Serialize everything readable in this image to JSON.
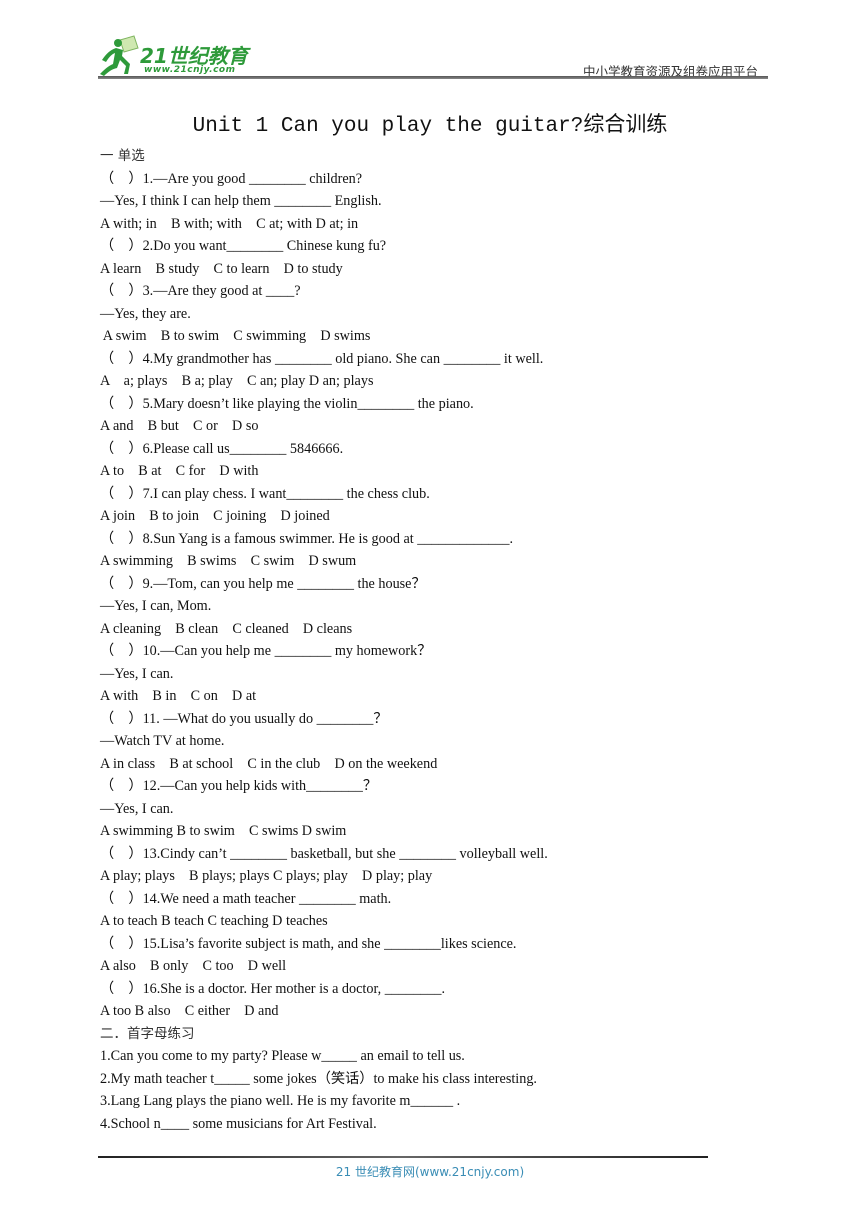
{
  "header": {
    "logo_text": "21世纪教育",
    "logo_url": "www.21cnjy.com",
    "platform": "中小学教育资源及组卷应用平台"
  },
  "title": "Unit 1 Can you play the guitar?综合训练",
  "sections": [
    {
      "heading": "一 单选",
      "lines": [
        "（    ）1.—Are you good ________ children?",
        "—Yes, I think I can help them ________ English.",
        "A with; in    B with; with    C at; with D at; in",
        "（    ）2.Do you want________ Chinese kung fu?",
        "A learn    B study    C to learn    D to study",
        "（    ）3.—Are they good at ____?",
        "—Yes, they are.",
        " A swim    B to swim    C swimming    D swims",
        "（    ）4.My grandmother has ________ old piano. She can ________ it well.",
        "A    a; plays    B a; play    C an; play D an; plays",
        "（    ）5.Mary doesn’t like playing the violin________ the piano.",
        "A and    B but    C or    D so",
        "（    ）6.Please call us________ 5846666.",
        "A to    B at    C for    D with",
        "（    ）7.I can play chess. I want________ the chess club.",
        "A join    B to join    C joining    D joined",
        "（    ）8.Sun Yang is a famous swimmer. He is good at _____________.",
        "A swimming    B swims    C swim    D swum",
        "（    ）9.—Tom, can you help me ________ the house？",
        "—Yes, I can, Mom.",
        "A cleaning    B clean    C cleaned    D cleans",
        "（    ）10.—Can you help me ________ my homework？",
        "—Yes, I can.",
        "A with    B in    C on    D at",
        "（    ）11. —What do you usually do ________？",
        "—Watch TV at home.",
        "A in class    B at school    C in the club    D on the weekend",
        "（    ）12.—Can you help kids with________？",
        "—Yes, I can.",
        "A swimming B to swim    C swims D swim",
        "（    ）13.Cindy can’t ________ basketball, but she ________ volleyball well.",
        "A play; plays    B plays; plays C plays; play    D play; play",
        "（    ）14.We need a math teacher ________ math.",
        "A to teach B teach C teaching D teaches",
        "（    ）15.Lisa’s favorite subject is math, and she ________likes science.",
        "A also    B only    C too    D well",
        "（    ）16.She is a doctor. Her mother is a doctor, ________.",
        "A too B also    C either    D and"
      ]
    },
    {
      "heading": "二．首字母练习",
      "lines": [
        "1.Can you come to my party? Please w_____ an email to tell us.",
        "2.My math teacher t_____ some jokes（笑话）to make his class interesting.",
        "3.Lang Lang plays the piano well. He is my favorite m______ .",
        "4.School n____ some musicians for Art Festival."
      ]
    }
  ],
  "footer": "21 世纪教育网(www.21cnjy.com)"
}
